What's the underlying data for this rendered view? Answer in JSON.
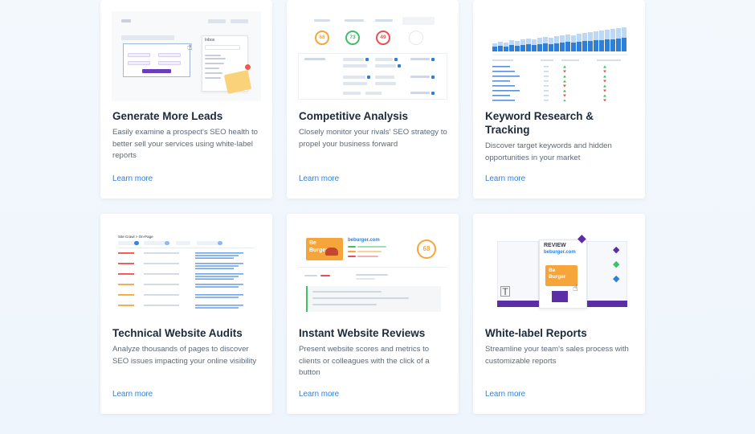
{
  "cards": [
    {
      "title": "Generate More Leads",
      "description": "Easily examine a prospect's SEO health to better sell your services using white-label reports",
      "link": "Learn more",
      "thumb": {
        "inbox_label": "Inbox"
      }
    },
    {
      "title": "Competitive Analysis",
      "description": "Closely monitor your rivals' SEO strategy to propel your business forward",
      "link": "Learn more",
      "thumb": {
        "scores": [
          "68",
          "73",
          "49"
        ]
      }
    },
    {
      "title": "Keyword Research & Tracking",
      "description": "Discover target keywords and hidden opportunities in your market",
      "link": "Learn more"
    },
    {
      "title": "Technical Website Audits",
      "description": "Analyze thousands of pages to discover SEO issues impacting your online visibility",
      "link": "Learn more",
      "thumb": {
        "heading": "Site Crawl > On-Page"
      }
    },
    {
      "title": "Instant Website Reviews",
      "description": "Present website scores and metrics to clients or colleagues with the click of a button",
      "link": "Learn more",
      "thumb": {
        "domain": "beburger.com",
        "score": "68",
        "logo_line1": "Be",
        "logo_line2": "Burger"
      }
    },
    {
      "title": "White-label Reports",
      "description": "Streamline your team's sales process with customizable reports",
      "link": "Learn more",
      "thumb": {
        "review": "REVIEW",
        "domain": "beburger.com",
        "logo_line1": "Be",
        "logo_line2": "Burger"
      }
    }
  ],
  "colors": {
    "accent_blue": "#2f7fd8",
    "title": "#1c2a3a",
    "body": "#5b6978",
    "purple": "#5b2ea6",
    "orange": "#f6a53b"
  }
}
